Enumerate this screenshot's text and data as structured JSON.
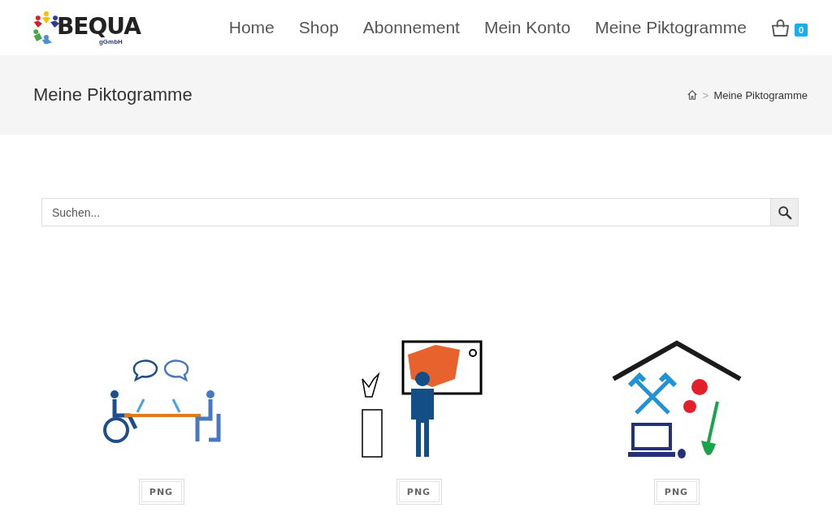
{
  "header": {
    "logo": {
      "name": "BEQUA",
      "sub": "gGmbH"
    },
    "nav": [
      {
        "label": "Home"
      },
      {
        "label": "Shop"
      },
      {
        "label": "Abonnement"
      },
      {
        "label": "Mein Konto"
      },
      {
        "label": "Meine Piktogramme"
      }
    ],
    "cart_count": "0"
  },
  "page_title": "Meine Piktogramme",
  "breadcrumb": {
    "separator": ">",
    "current": "Meine Piktogramme"
  },
  "search": {
    "placeholder": "Suchen..."
  },
  "pictograms": [
    {
      "kind": "meeting",
      "button": "PNG"
    },
    {
      "kind": "museum",
      "button": "PNG"
    },
    {
      "kind": "workshop",
      "button": "PNG"
    }
  ]
}
